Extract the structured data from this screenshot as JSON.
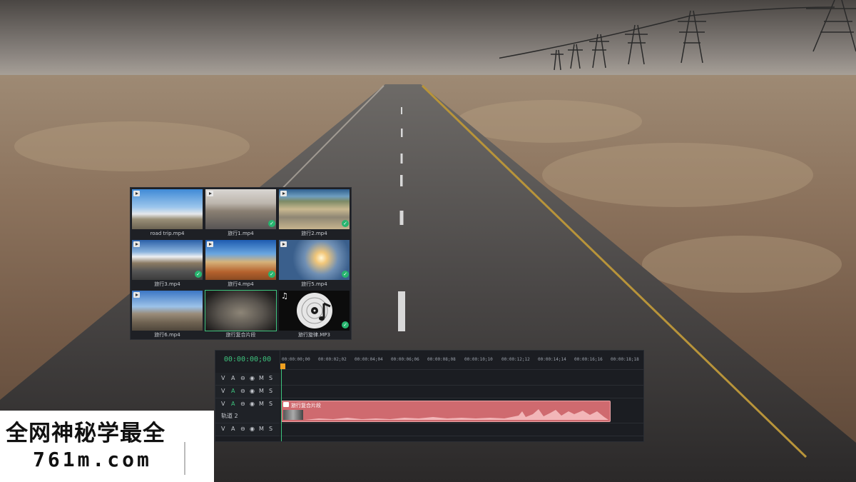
{
  "media": {
    "items": [
      {
        "label": "road trip.mp4",
        "checked": false,
        "icon": "play-badge-icon"
      },
      {
        "label": "旅行1.mp4",
        "checked": true,
        "icon": "play-badge-icon"
      },
      {
        "label": "旅行2.mp4",
        "checked": true,
        "icon": "play-badge-icon"
      },
      {
        "label": "旅行3.mp4",
        "checked": true,
        "icon": "play-badge-icon"
      },
      {
        "label": "旅行4.mp4",
        "checked": true,
        "icon": "play-badge-icon"
      },
      {
        "label": "旅行5.mp4",
        "checked": true,
        "icon": "play-badge-icon"
      },
      {
        "label": "旅行6.mp4",
        "checked": false,
        "icon": "play-badge-icon"
      },
      {
        "label": "旅行复合片段",
        "checked": false,
        "icon": "none"
      },
      {
        "label": "旅行旋律.MP3",
        "checked": true,
        "icon": "music-note-icon"
      }
    ]
  },
  "timeline": {
    "timecode": "00:00:00;00",
    "ticks": [
      "00:00:00;00",
      "00:00:02;02",
      "00:00:04;04",
      "00:00:06;06",
      "00:00:08;08",
      "00:00:10;10",
      "00:00:12;12",
      "00:00:14;14",
      "00:00:16;16",
      "00:00:18;18"
    ],
    "track_buttons": [
      "V",
      "A",
      "⊖",
      "◉",
      "M",
      "S"
    ],
    "track_name": "轨道 2",
    "clip_title": "旅行复合片段",
    "accent_color": "#3ec47e",
    "clip_color": "#cf6a6f"
  },
  "watermark": {
    "line1": "全网神秘学最全",
    "line2": "761m.com"
  }
}
